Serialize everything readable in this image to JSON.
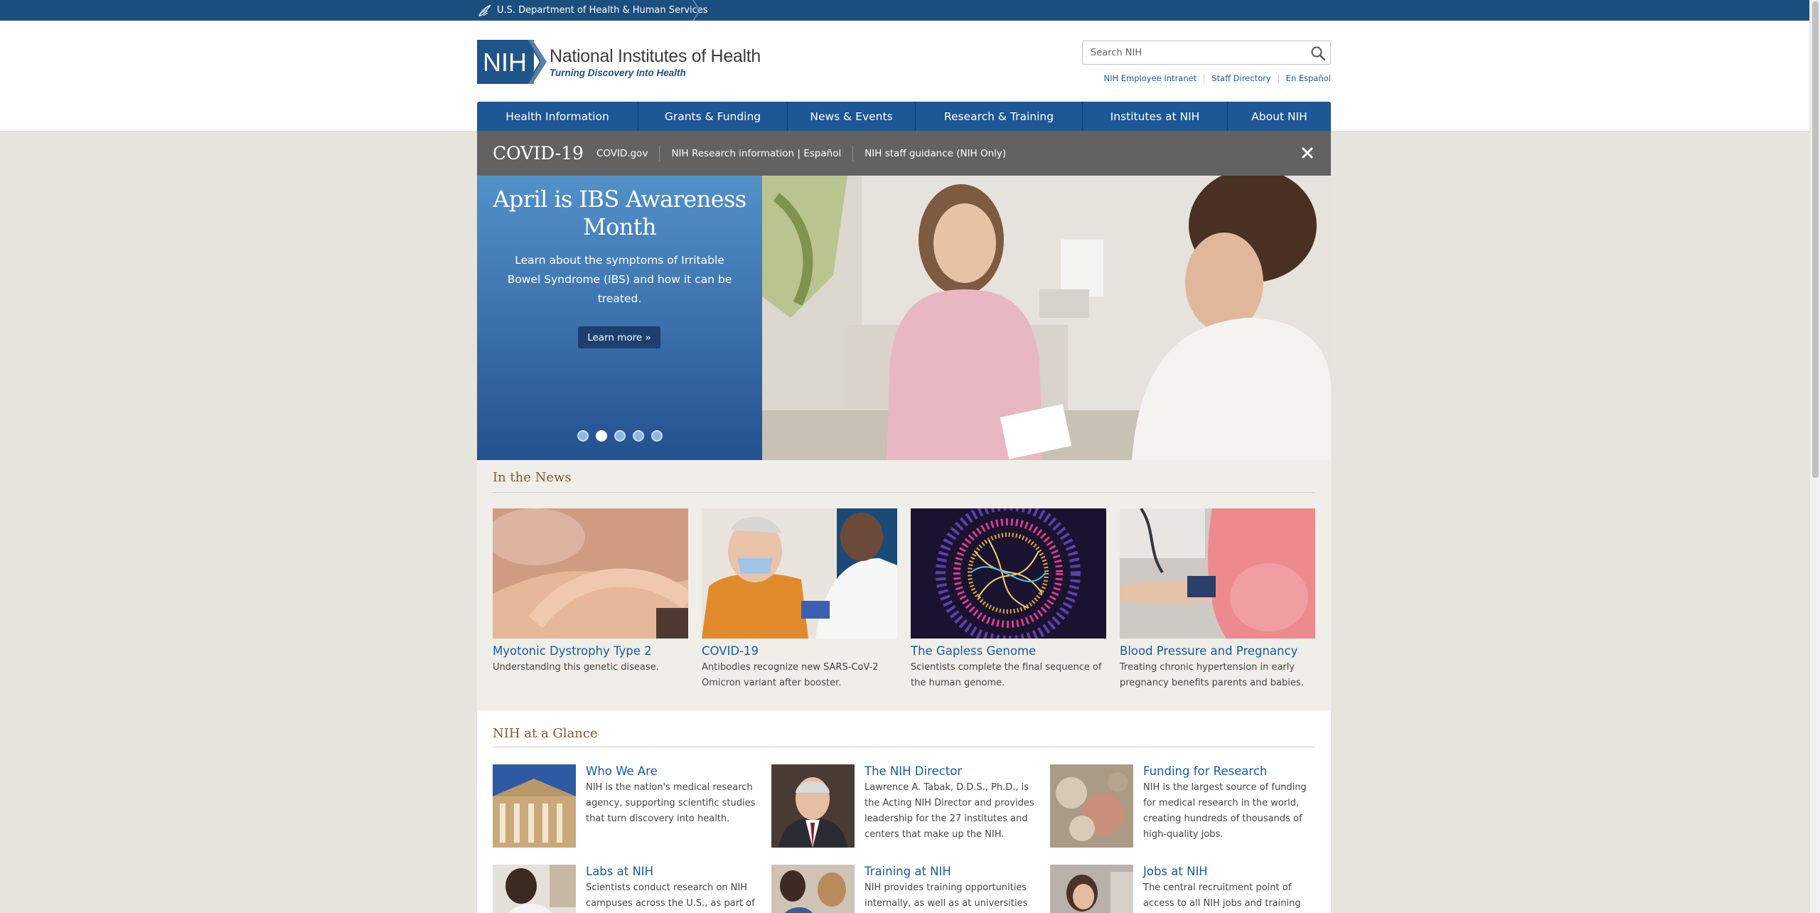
{
  "hhs": {
    "label": "U.S. Department of Health & Human Services"
  },
  "header": {
    "logo_badge": "NIH",
    "logo_name": "National Institutes of Health",
    "logo_tagline": "Turning Discovery Into Health",
    "search_placeholder": "Search NIH",
    "util_links": [
      "NIH Employee Intranet",
      "Staff Directory",
      "En Español"
    ]
  },
  "nav": {
    "items": [
      "Health Information",
      "Grants & Funding",
      "News & Events",
      "Research & Training",
      "Institutes at NIH",
      "About NIH"
    ]
  },
  "covid": {
    "title": "COVID-19",
    "links": [
      "COVID.gov",
      "NIH Research information | Español",
      "NIH staff guidance (NIH Only)"
    ]
  },
  "hero": {
    "title": "April is IBS Awareness Month",
    "description": "Learn about the symptoms of Irritable Bowel Syndrome (IBS) and how it can be treated.",
    "button": "Learn more »",
    "slide_count": 5,
    "active_slide": 2
  },
  "news": {
    "heading": "In the News",
    "cards": [
      {
        "title": "Myotonic Dystrophy Type 2",
        "desc": "Understanding this genetic disease."
      },
      {
        "title": "COVID-19",
        "desc": "Antibodies recognize new SARS-CoV-2 Omicron variant after booster."
      },
      {
        "title": "The Gapless Genome",
        "desc": "Scientists complete the final sequence of the human genome."
      },
      {
        "title": "Blood Pressure and Pregnancy",
        "desc": "Treating chronic hypertension in early pregnancy benefits parents and babies."
      }
    ]
  },
  "glance": {
    "heading": "NIH at a Glance",
    "items": [
      {
        "title": "Who We Are",
        "desc": "NIH is the nation's medical research agency, supporting scientific studies that turn discovery into health."
      },
      {
        "title": "The NIH Director",
        "desc": "Lawrence A. Tabak, D.D.S., Ph.D., is the Acting NIH Director and provides leadership for the 27 institutes and centers that make up the NIH."
      },
      {
        "title": "Funding for Research",
        "desc": "NIH is the largest source of funding for medical research in the world, creating hundreds of thousands of high-quality jobs."
      },
      {
        "title": "Labs at NIH",
        "desc": "Scientists conduct research on NIH campuses across the U.S., as part of"
      },
      {
        "title": "Training at NIH",
        "desc": "NIH provides training opportunities internally, as well as at universities"
      },
      {
        "title": "Jobs at NIH",
        "desc": "The central recruitment point of access to all NIH jobs and training"
      }
    ]
  },
  "colors": {
    "hhs_bar": "#1b4f7f",
    "nav": "#1d5795",
    "covid_bar": "#626262",
    "link": "#1a5a9a",
    "heading": "#8a5b2b"
  }
}
